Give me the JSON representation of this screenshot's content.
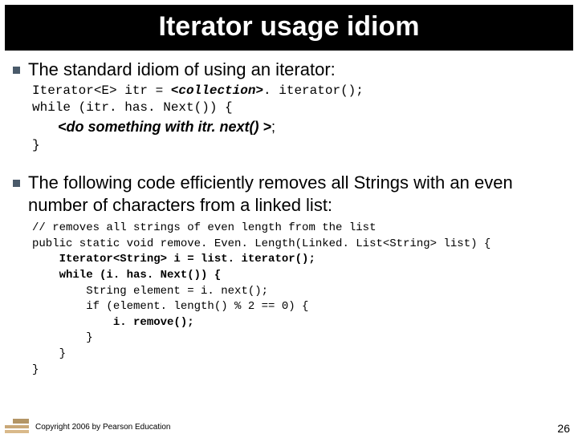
{
  "title": "Iterator usage idiom",
  "bullets": {
    "b1": "The standard idiom of using an iterator:",
    "b2": "The following code efficiently removes all Strings with an even number of characters from a linked list:"
  },
  "code1": {
    "l1a": "Iterator<E> itr = ",
    "l1b": "<collection>",
    "l1c": ". iterator();",
    "l2": "while (itr. has. Next()) {",
    "action_a": "<do something with itr. next() >",
    "action_b": ";",
    "l4": "}"
  },
  "code2": {
    "c1": "// removes all strings of even length from the list",
    "c2": "public static void remove. Even. Length(Linked. List<String> list) {",
    "c3": "    Iterator<String> i = list. iterator();",
    "c4": "    while (i. has. Next()) {",
    "c5": "        String element = i. next();",
    "c6": "        if (element. length() % 2 == 0) {",
    "c7": "            i. remove();",
    "c8": "        }",
    "c9": "    }",
    "c10": "}"
  },
  "footer": {
    "copyright": "Copyright 2006 by Pearson Education",
    "page": "26"
  }
}
